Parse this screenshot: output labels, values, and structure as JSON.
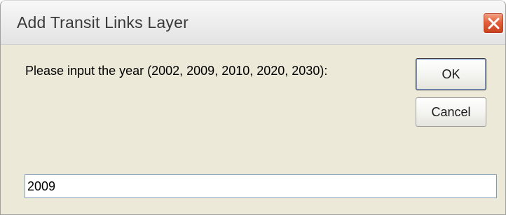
{
  "window": {
    "title": "Add Transit Links Layer",
    "close_icon": "close-icon"
  },
  "dialog": {
    "prompt": "Please input the year (2002, 2009, 2010, 2020, 2030):",
    "ok_label": "OK",
    "cancel_label": "Cancel",
    "input_value": "2009"
  },
  "colors": {
    "dialog_background": "#ece9d8",
    "close_button": "#d9502a"
  }
}
